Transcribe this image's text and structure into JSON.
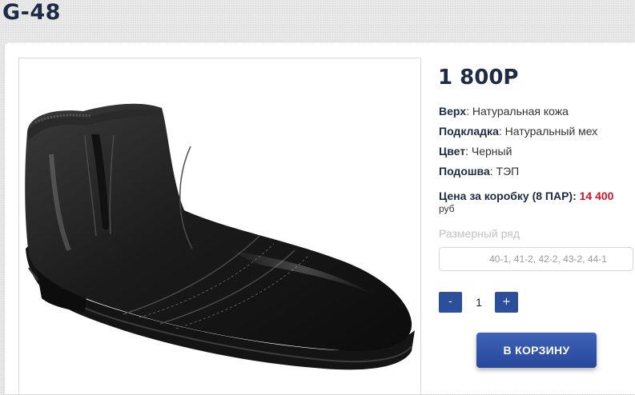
{
  "product": {
    "title": "G-48",
    "price": "1 800Р",
    "image_alt": "black-leather-ankle-boot"
  },
  "specs": [
    {
      "label": "Верх",
      "value": "Натуральная кожа"
    },
    {
      "label": "Подкладка",
      "value": "Натуральный мех"
    },
    {
      "label": "Цвет",
      "value": "Черный"
    },
    {
      "label": "Подошва",
      "value": "ТЭП"
    }
  ],
  "box_price": {
    "label": "Цена за коробку (8 ПАР):",
    "amount": "14 400",
    "unit": "руб"
  },
  "sizes": {
    "label": "Размерный ряд",
    "selected": "40-1, 41-2, 42-2, 43-2, 44-1"
  },
  "quantity": {
    "minus_label": "-",
    "value": "1",
    "plus_label": "+"
  },
  "cart": {
    "button_label": "В КОРЗИНУ"
  },
  "colors": {
    "accent": "#2b4f9a",
    "title": "#1f2b44",
    "highlight": "#d0152b"
  }
}
